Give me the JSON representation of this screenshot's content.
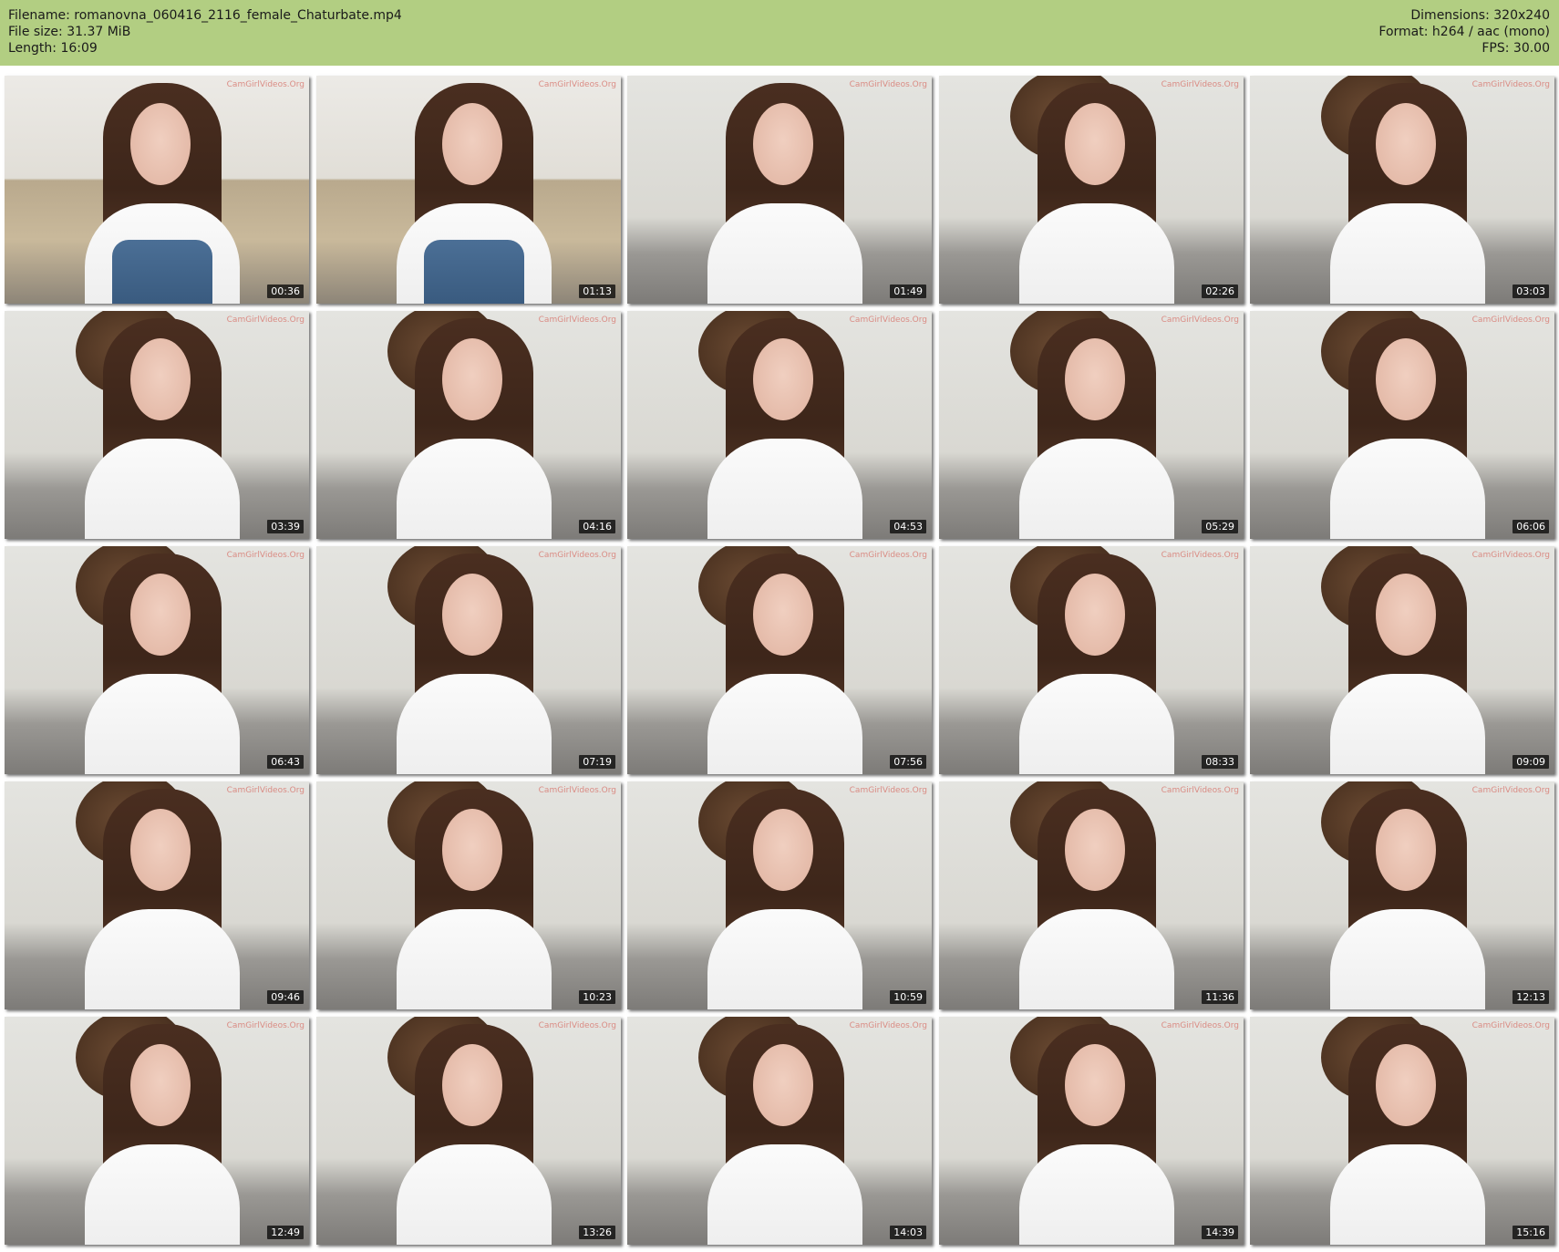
{
  "header": {
    "filename": "Filename: romanovna_060416_2116_female_Chaturbate.mp4",
    "filesize": "File size: 31.37 MiB",
    "length": "Length: 16:09",
    "dimensions": "Dimensions: 320x240",
    "format": "Format: h264 / aac (mono)",
    "fps": "FPS: 30.00"
  },
  "colors": {
    "header_bg": "#b2ce82",
    "timestamp_bg": "#000000"
  },
  "watermark": "CamGirlVideos.Org",
  "thumbnails": [
    {
      "time": "00:36"
    },
    {
      "time": "01:13"
    },
    {
      "time": "01:49"
    },
    {
      "time": "02:26"
    },
    {
      "time": "03:03"
    },
    {
      "time": "03:39"
    },
    {
      "time": "04:16"
    },
    {
      "time": "04:53"
    },
    {
      "time": "05:29"
    },
    {
      "time": "06:06"
    },
    {
      "time": "06:43"
    },
    {
      "time": "07:19"
    },
    {
      "time": "07:56"
    },
    {
      "time": "08:33"
    },
    {
      "time": "09:09"
    },
    {
      "time": "09:46"
    },
    {
      "time": "10:23"
    },
    {
      "time": "10:59"
    },
    {
      "time": "11:36"
    },
    {
      "time": "12:13"
    },
    {
      "time": "12:49"
    },
    {
      "time": "13:26"
    },
    {
      "time": "14:03"
    },
    {
      "time": "14:39"
    },
    {
      "time": "15:16"
    }
  ]
}
